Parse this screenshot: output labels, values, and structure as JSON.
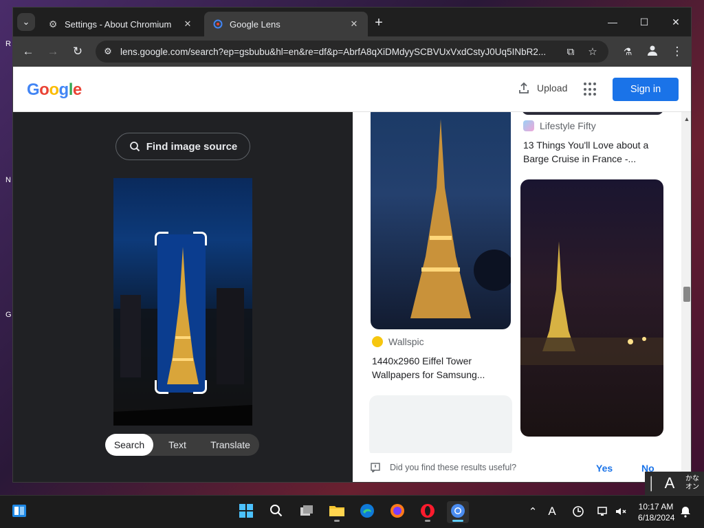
{
  "window": {
    "tabs": [
      {
        "title": "Settings - About Chromium",
        "icon": "gear-icon",
        "active": false
      },
      {
        "title": "Google Lens",
        "icon": "google-lens-icon",
        "active": true
      }
    ],
    "url": "lens.google.com/search?ep=gsbubu&hl=en&re=df&p=AbrfA8qXiDMdyySCBVUxVxdCstyJ0Uq5INbR2..."
  },
  "header": {
    "logo": "Google",
    "upload_label": "Upload",
    "signin_label": "Sign in"
  },
  "lens": {
    "find_source_label": "Find image source",
    "modes": [
      "Search",
      "Text",
      "Translate"
    ],
    "active_mode": "Search"
  },
  "results": [
    {
      "source": "Lifestyle Fifty",
      "title_line1": "13 Things You'll Love about a",
      "title_line2": "Barge Cruise in France -..."
    },
    {
      "source": "Wallspic",
      "title_line1": "1440x2960 Eiffel Tower",
      "title_line2": "Wallpapers for Samsung..."
    }
  ],
  "feedback": {
    "question": "Did you find these results useful?",
    "yes": "Yes",
    "no": "No"
  },
  "ime": {
    "mode_char": "A",
    "kana_line1": "かな",
    "kana_line2": "オン"
  },
  "taskbar": {
    "time": "10:17 AM",
    "date": "6/18/2024",
    "ime_indicator": "A"
  },
  "desktop": {
    "peek_letter_1": "R",
    "peek_letter_2": "N",
    "peek_letter_3": "G"
  },
  "colors": {
    "accent": "#1a73e8",
    "lens_dark": "#202124"
  }
}
